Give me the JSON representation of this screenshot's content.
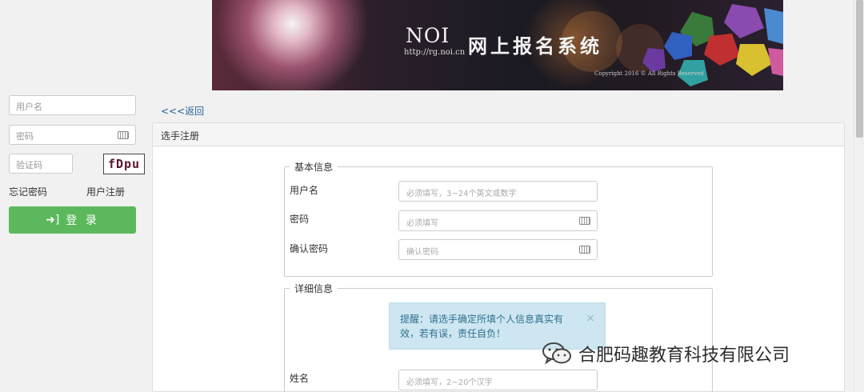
{
  "banner": {
    "logo": "NOI",
    "url": "http://rg.noi.cn",
    "system_name": "网上报名系统",
    "copyright": "Copyright 2016 © All Rights Reserved"
  },
  "login": {
    "username_placeholder": "用户名",
    "password_placeholder": "密码",
    "captcha_placeholder": "验证码",
    "captcha_text": "fDpu",
    "forgot_password": "忘记密码",
    "register": "用户注册",
    "login_button": "登 录"
  },
  "main": {
    "back_link": "<<<返回",
    "panel_title": "选手注册",
    "basic_info": {
      "legend": "基本信息",
      "fields": [
        {
          "label": "用户名",
          "placeholder": "必须填写，3~24个英文或数字"
        },
        {
          "label": "密码",
          "placeholder": "必须填写"
        },
        {
          "label": "确认密码",
          "placeholder": "确认密码"
        }
      ]
    },
    "detail_info": {
      "legend": "详细信息",
      "fields": [
        {
          "label": "姓名",
          "placeholder": "必须填写，2~20个汉字"
        }
      ]
    }
  },
  "toast": {
    "message": "提醒：请选手确定所填个人信息真实有效，若有误，责任自负！",
    "close": "×"
  },
  "watermark": {
    "text": "合肥码趣教育科技有限公司"
  }
}
